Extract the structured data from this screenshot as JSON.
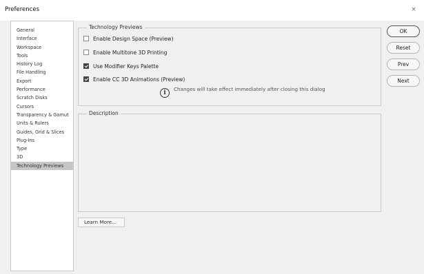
{
  "window": {
    "title": "Preferences",
    "close_glyph": "×"
  },
  "sidebar": {
    "items": [
      {
        "label": "General"
      },
      {
        "label": "Interface"
      },
      {
        "label": "Workspace"
      },
      {
        "label": "Tools"
      },
      {
        "label": "History Log"
      },
      {
        "label": "File Handling"
      },
      {
        "label": "Export"
      },
      {
        "label": "Performance"
      },
      {
        "label": "Scratch Disks"
      },
      {
        "label": "Cursors"
      },
      {
        "label": "Transparency & Gamut"
      },
      {
        "label": "Units & Rulers"
      },
      {
        "label": "Guides, Grid & Slices"
      },
      {
        "label": "Plug-Ins"
      },
      {
        "label": "Type"
      },
      {
        "label": "3D"
      },
      {
        "label": "Technology Previews"
      }
    ],
    "selected_label": "Technology Previews"
  },
  "tech_previews": {
    "legend": "Technology Previews",
    "options": [
      {
        "label": "Enable Design Space (Preview)",
        "checked": false
      },
      {
        "label": "Enable Multitone 3D Printing",
        "checked": false
      },
      {
        "label": "Use Modifier Keys Palette",
        "checked": true
      },
      {
        "label": "Enable CC 3D Animations (Preview)",
        "checked": true
      }
    ],
    "info_icon": "info-circle-icon",
    "info_glyph": "i",
    "info_text": "Changes will take effect immediately after closing this dialog"
  },
  "description": {
    "legend": "Description"
  },
  "learn_more_label": "Learn More...",
  "buttons": {
    "ok": "OK",
    "reset": "Reset",
    "prev": "Prev",
    "next": "Next"
  }
}
